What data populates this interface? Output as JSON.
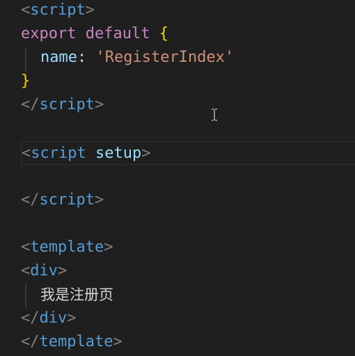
{
  "code": {
    "line1": {
      "open": "<",
      "tag": "script",
      "close": ">"
    },
    "line2": {
      "export": "export",
      "default": "default",
      "brace": "{"
    },
    "line3": {
      "key": "name",
      "colon": ":",
      "value": "'RegisterIndex'"
    },
    "line4": {
      "brace": "}"
    },
    "line5": {
      "open": "</",
      "tag": "script",
      "close": ">"
    },
    "line7": {
      "open": "<",
      "tag": "script",
      "attr": "setup",
      "close": ">"
    },
    "line9": {
      "open": "</",
      "tag": "script",
      "close": ">"
    },
    "line11": {
      "open": "<",
      "tag": "template",
      "close": ">"
    },
    "line12": {
      "open": "<",
      "tag": "div",
      "close": ">"
    },
    "line13": {
      "text": "我是注册页"
    },
    "line14": {
      "open": "</",
      "tag": "div",
      "close": ">"
    },
    "line15": {
      "open": "</",
      "tag": "template",
      "close": ">"
    }
  },
  "colors": {
    "background": "#1f1f1f",
    "tag": "#569cd6",
    "keyword": "#c586c0",
    "string": "#ce9178",
    "property": "#9cdcfe",
    "brace": "#ffd700"
  },
  "icons": {
    "cursor": "text-cursor-icon"
  }
}
